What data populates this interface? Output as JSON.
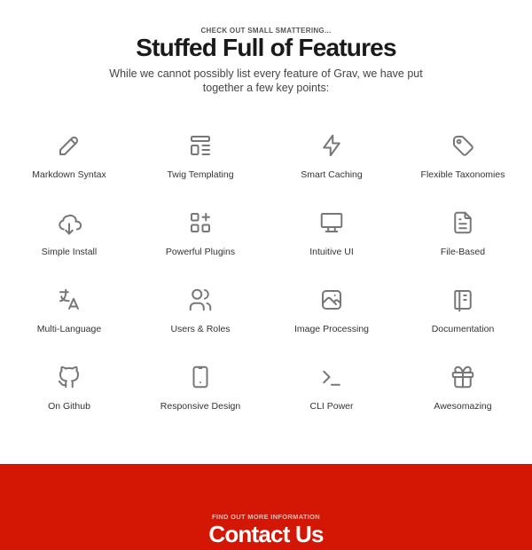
{
  "features_section": {
    "eyebrow": "CHECK OUT SMALL SMATTERING...",
    "title": "Stuffed Full of Features",
    "subtitle": "While we cannot possibly list every feature of Grav, we have put together a few key points:",
    "items": [
      {
        "label": "Markdown Syntax",
        "icon": "pencil-icon"
      },
      {
        "label": "Twig Templating",
        "icon": "layout-template-icon"
      },
      {
        "label": "Smart Caching",
        "icon": "lightning-bolt-icon"
      },
      {
        "label": "Flexible Taxonomies",
        "icon": "tag-icon"
      },
      {
        "label": "Simple Install",
        "icon": "cloud-download-icon"
      },
      {
        "label": "Powerful Plugins",
        "icon": "apps-add-icon"
      },
      {
        "label": "Intuitive UI",
        "icon": "monitor-icon"
      },
      {
        "label": "File-Based",
        "icon": "file-text-icon"
      },
      {
        "label": "Multi-Language",
        "icon": "language-icon"
      },
      {
        "label": "Users & Roles",
        "icon": "users-icon"
      },
      {
        "label": "Image Processing",
        "icon": "photo-icon"
      },
      {
        "label": "Documentation",
        "icon": "notebook-icon"
      },
      {
        "label": "On Github",
        "icon": "github-icon"
      },
      {
        "label": "Responsive Design",
        "icon": "mobile-phone-icon"
      },
      {
        "label": "CLI Power",
        "icon": "terminal-icon"
      },
      {
        "label": "Awesomazing",
        "icon": "gift-icon"
      }
    ]
  },
  "contact_section": {
    "eyebrow": "FIND OUT MORE INFORMATION",
    "title": "Contact Us",
    "background_color": "#d41705"
  },
  "colors": {
    "icon": "#777777",
    "title": "#1a1a1a",
    "accent": "#d41705"
  }
}
